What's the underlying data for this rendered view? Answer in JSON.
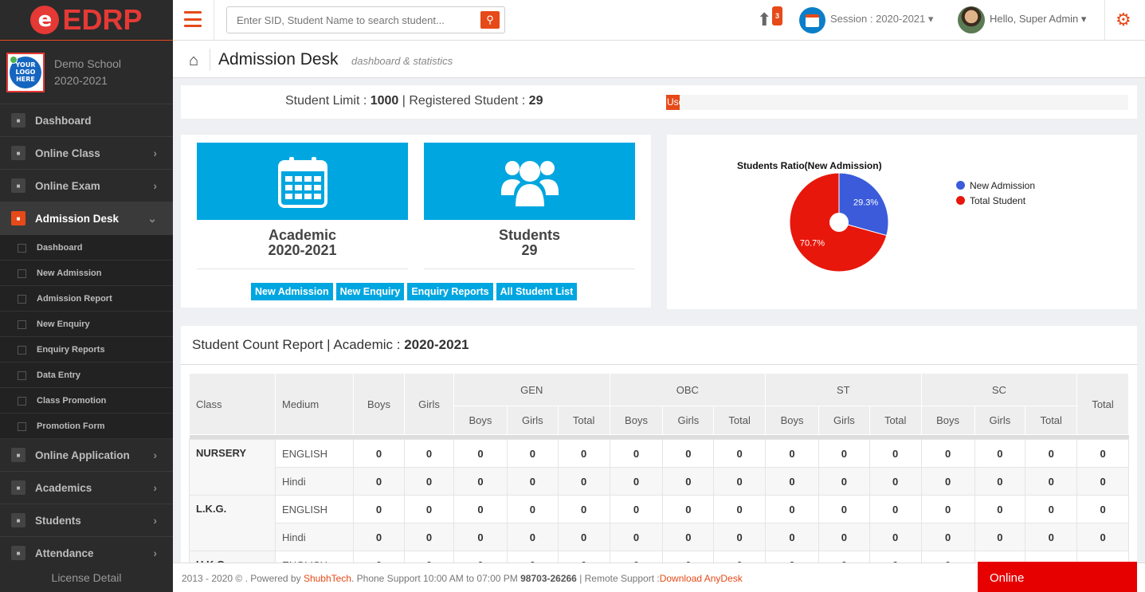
{
  "brand": {
    "logo_letter": "e",
    "name": "EDRP"
  },
  "school": {
    "logo_text": "YOUR LOGO HERE",
    "name": "Demo School",
    "year": "2020-2021"
  },
  "sidebar": {
    "items": [
      {
        "label": "Dashboard",
        "icon": "dashboard-icon",
        "chevron": ""
      },
      {
        "label": "Online Class",
        "icon": "monitor-icon",
        "chevron": "›"
      },
      {
        "label": "Online Exam",
        "icon": "edit-icon",
        "chevron": "›"
      },
      {
        "label": "Admission Desk",
        "icon": "user-plus-icon",
        "chevron": "⌄"
      }
    ],
    "subitems": [
      "Dashboard",
      "New Admission",
      "Admission Report",
      "New Enquiry",
      "Enquiry Reports",
      "Data Entry",
      "Class Promotion",
      "Promotion Form"
    ],
    "items2": [
      {
        "label": "Online Application",
        "icon": "globe-icon",
        "chevron": "›"
      },
      {
        "label": "Academics",
        "icon": "book-icon",
        "chevron": "›"
      },
      {
        "label": "Students",
        "icon": "users-icon",
        "chevron": "›"
      },
      {
        "label": "Attendance",
        "icon": "hand-icon",
        "chevron": "›"
      }
    ],
    "license": "License Detail"
  },
  "topbar": {
    "search_placeholder": "Enter SID, Student Name to search student...",
    "upload_count": "3",
    "session": "Session : 2020-2021 ▾",
    "hello": "Hello, Super Admin ▾"
  },
  "page": {
    "title": "Admission Desk",
    "subtitle": "dashboard & statistics"
  },
  "limit": {
    "limit_label": "Student Limit : ",
    "limit": "1000",
    "sep": " | Registered Student : ",
    "registered": "29",
    "bar_text": "Used",
    "used_fraction": 0.029
  },
  "cards": [
    {
      "title": "Academic",
      "value": "2020-2021",
      "icon": "calendar-icon"
    },
    {
      "title": "Students",
      "value": "29",
      "icon": "users-icon"
    }
  ],
  "buttons": [
    "New Admission",
    "New Enquiry",
    "Enquiry Reports",
    "All Student List"
  ],
  "chart_data": {
    "type": "pie",
    "title": "Students Ratio(New Admission)",
    "labels": [
      "New Admission",
      "Total Student"
    ],
    "values": [
      29.3,
      70.7
    ],
    "value_labels": [
      "29.3%",
      "70.7%"
    ],
    "colors": [
      "#3b5bdb",
      "#e8170b"
    ],
    "legend": "right"
  },
  "report": {
    "title_prefix": "Student Count Report | Academic : ",
    "title_year": "2020-2021",
    "headers": {
      "class": "Class",
      "medium": "Medium",
      "boys": "Boys",
      "girls": "Girls",
      "total": "Total",
      "groups": [
        "GEN",
        "OBC",
        "ST",
        "SC"
      ],
      "sub": [
        "Boys",
        "Girls",
        "Total"
      ]
    },
    "rows": [
      {
        "class": "NURSERY",
        "medium": "ENGLISH",
        "values": [
          "0",
          "0",
          "0",
          "0",
          "0",
          "0",
          "0",
          "0",
          "0",
          "0",
          "0",
          "0",
          "0",
          "0",
          "0"
        ]
      },
      {
        "class": "",
        "medium": "Hindi",
        "values": [
          "0",
          "0",
          "0",
          "0",
          "0",
          "0",
          "0",
          "0",
          "0",
          "0",
          "0",
          "0",
          "0",
          "0",
          "0"
        ]
      },
      {
        "class": "L.K.G.",
        "medium": "ENGLISH",
        "values": [
          "0",
          "0",
          "0",
          "0",
          "0",
          "0",
          "0",
          "0",
          "0",
          "0",
          "0",
          "0",
          "0",
          "0",
          "0"
        ]
      },
      {
        "class": "",
        "medium": "Hindi",
        "values": [
          "0",
          "0",
          "0",
          "0",
          "0",
          "0",
          "0",
          "0",
          "0",
          "0",
          "0",
          "0",
          "0",
          "0",
          "0"
        ]
      },
      {
        "class": "U.K.G.",
        "medium": "ENGLISH",
        "values": [
          "0",
          "0",
          "0",
          "0",
          "0",
          "0",
          "0",
          "0",
          "0",
          "0",
          "0",
          "0",
          "0",
          "0",
          "0"
        ]
      }
    ]
  },
  "footer": {
    "prefix": "2013 - 2020 © . Powered by ",
    "company": "ShubhTech",
    "mid": ". Phone Support 10:00 AM to 07:00 PM ",
    "phone": "98703-26266",
    "remote": " | Remote Support :",
    "download": "Download AnyDesk"
  },
  "status": "Online"
}
